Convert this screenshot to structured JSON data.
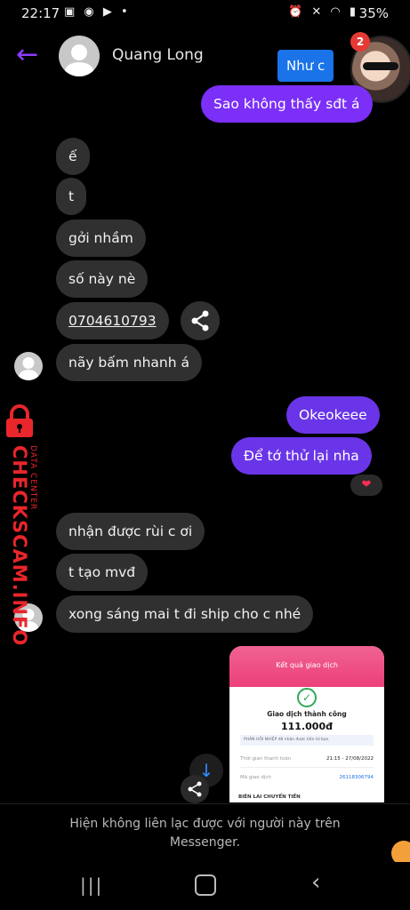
{
  "status_bar": {
    "time": "22:17",
    "battery": "35%",
    "left_icons": [
      "gallery-icon",
      "messenger-icon",
      "youtube-icon",
      "dot-icon"
    ],
    "right_icons": [
      "alarm-icon",
      "mute-icon",
      "wifi-icon",
      "signal-icon",
      "battery-icon"
    ]
  },
  "header": {
    "contact_name": "Quang Long"
  },
  "chat_head": {
    "badge_count": "2",
    "tooltip": "Như c"
  },
  "messages": [
    {
      "from": "me",
      "text": "Sao không thấy sđt á"
    },
    {
      "from": "them",
      "text": "ế"
    },
    {
      "from": "them",
      "text": "t"
    },
    {
      "from": "them",
      "text": "gởi nhầm"
    },
    {
      "from": "them",
      "text": "số này nè"
    },
    {
      "from": "them",
      "text": "0704610793"
    },
    {
      "from": "them",
      "text": "nãy bấm nhanh á"
    },
    {
      "from": "me",
      "text": "Okeokeee"
    },
    {
      "from": "me",
      "text": "Để tớ thử lại nha"
    },
    {
      "from": "them",
      "text": "nhận được rùi c ơi"
    },
    {
      "from": "them",
      "text": "t tạo mvđ"
    },
    {
      "from": "them",
      "text": "xong sáng mai t đi ship cho c nhé"
    }
  ],
  "reaction": "❤",
  "watermark": {
    "brand": "CHECKSCAM.INFO",
    "sub": "DATA CENTER"
  },
  "shared_image": {
    "header": "Kết quả giao dịch",
    "status": "Giao dịch thành công",
    "amount": "111.000đ",
    "info_note": "PHẢN HỒI NHIỆP đã nhận được tiền từ bạn",
    "time_label": "Thời gian thanh toán",
    "time_value": "21:15 - 27/08/2022",
    "id_label": "Mã giao dịch",
    "id_value": "26118306794",
    "footer": "BIÊN LAI CHUYỂN TIỀN"
  },
  "footer_notice": {
    "line1": "Hiện không liên lạc được với người này trên",
    "line2": "Messenger."
  },
  "colors": {
    "accent": "#7b2ff7",
    "incoming": "#303030",
    "watermark": "#e8262b"
  }
}
